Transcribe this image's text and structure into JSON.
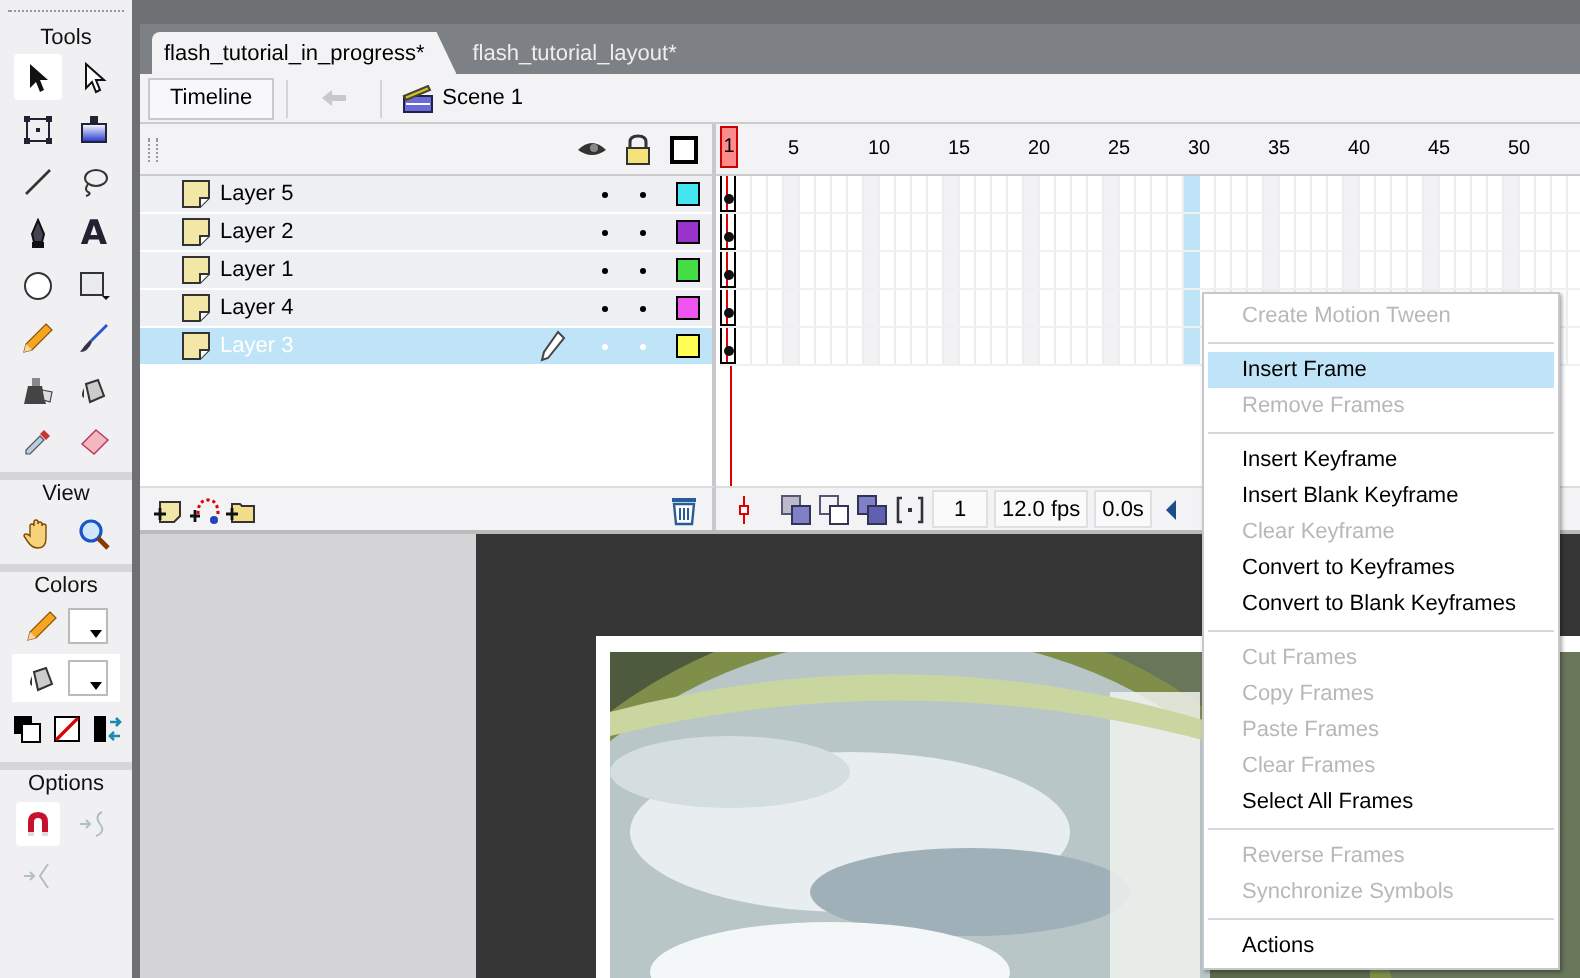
{
  "tools": [
    {
      "title": "Tools",
      "items": [
        {
          "kind": "arrow",
          "selected": true
        },
        {
          "kind": "subselect",
          "selected": false
        },
        {
          "kind": "transform",
          "selected": false
        },
        {
          "kind": "gradient",
          "selected": false
        },
        {
          "kind": "line",
          "selected": false
        },
        {
          "kind": "lasso",
          "selected": false
        },
        {
          "kind": "pen",
          "selected": false
        },
        {
          "kind": "text",
          "glyph": "A",
          "selected": false
        },
        {
          "kind": "oval",
          "selected": false
        },
        {
          "kind": "rect",
          "selected": false
        },
        {
          "kind": "pencil",
          "selected": false
        },
        {
          "kind": "brush",
          "selected": false
        },
        {
          "kind": "inkbottle",
          "selected": false
        },
        {
          "kind": "bucket",
          "selected": false
        },
        {
          "kind": "dropper",
          "selected": false
        },
        {
          "kind": "eraser",
          "selected": false
        }
      ]
    },
    {
      "title": "View",
      "items": [
        {
          "kind": "hand",
          "selected": false
        },
        {
          "kind": "zoom",
          "selected": false
        }
      ]
    },
    {
      "title": "Colors",
      "items": [
        {
          "kind": "stroke",
          "color": "#ffffff"
        },
        {
          "kind": "fill",
          "color": "#ffffff"
        },
        {
          "kind": "defaults"
        },
        {
          "kind": "nocolor"
        },
        {
          "kind": "swap"
        }
      ]
    },
    {
      "title": "Options",
      "items": [
        {
          "kind": "magnet",
          "disabled": false
        },
        {
          "kind": "smooth",
          "disabled": true
        },
        {
          "kind": "straighten",
          "disabled": true
        }
      ]
    }
  ],
  "document_tabs": [
    {
      "label": "flash_tutorial_in_progress*",
      "selected": true
    },
    {
      "label": "flash_tutorial_layout*",
      "selected": false
    }
  ],
  "edit_bar": {
    "timeline_button": "Timeline",
    "scene": "Scene 1"
  },
  "timeline": {
    "ruler": [
      {
        "label": "1",
        "selected": false
      },
      {
        "label": "5",
        "selected": false
      },
      {
        "label": "10",
        "selected": false
      },
      {
        "label": "15",
        "selected": false
      },
      {
        "label": "20",
        "selected": false
      },
      {
        "label": "25",
        "selected": false
      },
      {
        "label": "30",
        "selected": true
      },
      {
        "label": "35",
        "selected": false
      },
      {
        "label": "40",
        "selected": false
      },
      {
        "label": "45",
        "selected": false
      },
      {
        "label": "50",
        "selected": false
      }
    ],
    "layers": [
      {
        "name": "Layer 5",
        "selected": false,
        "color": "#44e4f0"
      },
      {
        "name": "Layer 2",
        "selected": false,
        "color": "#9933cc"
      },
      {
        "name": "Layer 1",
        "selected": false,
        "color": "#44dd44"
      },
      {
        "name": "Layer 4",
        "selected": false,
        "color": "#ee55ee"
      },
      {
        "name": "Layer 3",
        "selected": true,
        "color": "#ffff55"
      }
    ],
    "current_frame": "1",
    "frame_rate": "12.0 fps",
    "elapsed_time": "0.0s"
  },
  "context_menu": {
    "items": [
      {
        "kind": "item",
        "label": "Create Motion Tween",
        "disabled": true,
        "selected": false
      },
      {
        "kind": "separator"
      },
      {
        "kind": "item",
        "label": "Insert Frame",
        "disabled": false,
        "selected": true
      },
      {
        "kind": "item",
        "label": "Remove Frames",
        "disabled": true,
        "selected": false
      },
      {
        "kind": "separator"
      },
      {
        "kind": "item",
        "label": "Insert Keyframe",
        "disabled": false,
        "selected": false
      },
      {
        "kind": "item",
        "label": "Insert Blank Keyframe",
        "disabled": false,
        "selected": false
      },
      {
        "kind": "item",
        "label": "Clear Keyframe",
        "disabled": true,
        "selected": false
      },
      {
        "kind": "item",
        "label": "Convert to Keyframes",
        "disabled": false,
        "selected": false
      },
      {
        "kind": "item",
        "label": "Convert to Blank Keyframes",
        "disabled": false,
        "selected": false
      },
      {
        "kind": "separator"
      },
      {
        "kind": "item",
        "label": "Cut Frames",
        "disabled": true,
        "selected": false
      },
      {
        "kind": "item",
        "label": "Copy Frames",
        "disabled": true,
        "selected": false
      },
      {
        "kind": "item",
        "label": "Paste Frames",
        "disabled": true,
        "selected": false
      },
      {
        "kind": "item",
        "label": "Clear Frames",
        "disabled": true,
        "selected": false
      },
      {
        "kind": "item",
        "label": "Select All Frames",
        "disabled": false,
        "selected": false
      },
      {
        "kind": "separator"
      },
      {
        "kind": "item",
        "label": "Reverse Frames",
        "disabled": true,
        "selected": false
      },
      {
        "kind": "item",
        "label": "Synchronize Symbols",
        "disabled": true,
        "selected": false
      },
      {
        "kind": "separator"
      },
      {
        "kind": "item",
        "label": "Actions",
        "disabled": false,
        "selected": false
      }
    ]
  }
}
